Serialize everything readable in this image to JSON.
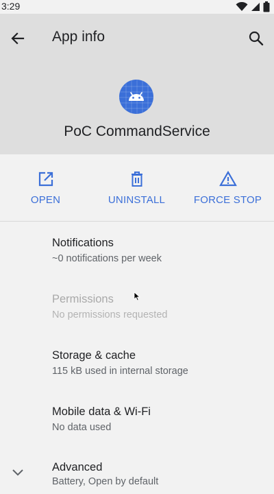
{
  "status_bar": {
    "time": "3:29",
    "icons": [
      "wifi-icon",
      "signal-icon",
      "battery-icon"
    ]
  },
  "toolbar": {
    "title": "App info",
    "back_icon": "arrow-left-icon",
    "search_icon": "search-icon"
  },
  "app": {
    "name": "PoC CommandService",
    "icon": "android-icon",
    "icon_color": "#3b6fd8"
  },
  "actions": [
    {
      "label": "OPEN",
      "icon": "open-in-new-icon"
    },
    {
      "label": "UNINSTALL",
      "icon": "trash-icon"
    },
    {
      "label": "FORCE STOP",
      "icon": "warning-icon"
    }
  ],
  "settings": [
    {
      "title": "Notifications",
      "subtitle": "~0 notifications per week",
      "enabled": true
    },
    {
      "title": "Permissions",
      "subtitle": "No permissions requested",
      "enabled": false
    },
    {
      "title": "Storage & cache",
      "subtitle": "115 kB used in internal storage",
      "enabled": true
    },
    {
      "title": "Mobile data & Wi-Fi",
      "subtitle": "No data used",
      "enabled": true
    },
    {
      "title": "Advanced",
      "subtitle": "Battery, Open by default",
      "enabled": true,
      "expand_icon": "chevron-down-icon"
    }
  ],
  "colors": {
    "accent": "#3b6fd8",
    "header_bg": "#dedede",
    "page_bg": "#f2f2f2"
  }
}
